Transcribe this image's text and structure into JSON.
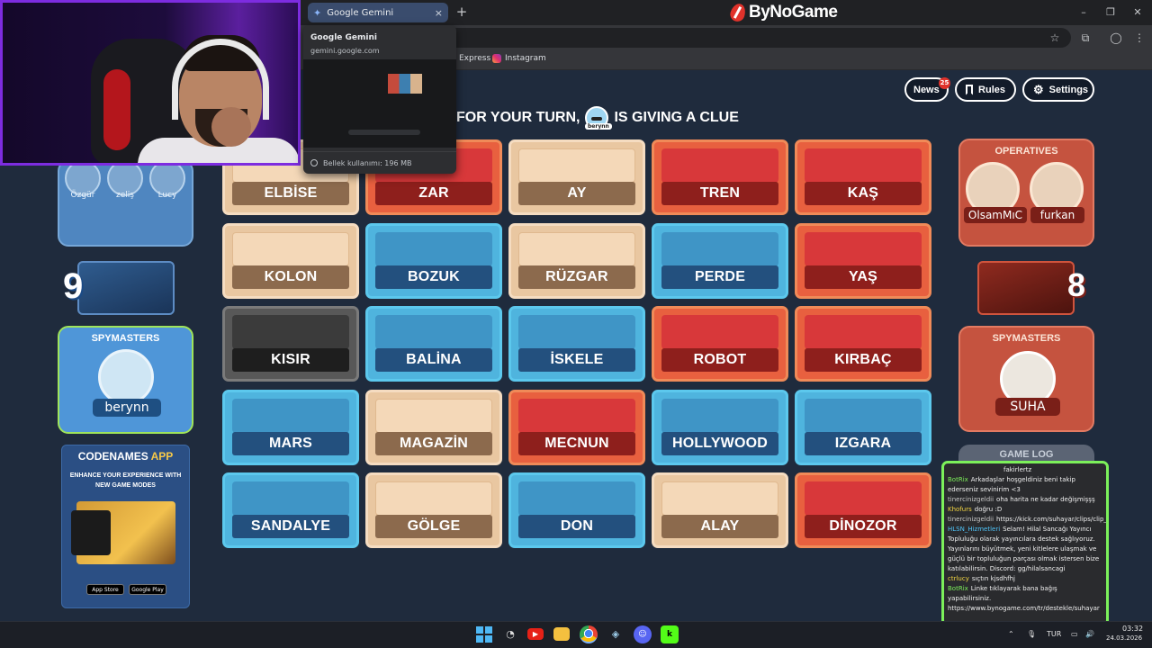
{
  "browser": {
    "tab_title": "Google Gemini",
    "tab_close": "×",
    "new_tab": "+",
    "brand": "ByNoGame",
    "window_controls": [
      "–",
      "❐",
      "✕"
    ],
    "bookmarks": [
      "Express",
      "Instagram"
    ]
  },
  "hover_card": {
    "title": "Google Gemini",
    "url": "gemini.google.com",
    "memory": "Bellek kullanımı: 196 MB"
  },
  "header": {
    "news_label": "News",
    "news_badge": "25",
    "rules_label": "Rules",
    "settings_label": "Settings",
    "status_text": "FOR YOUR TURN,",
    "status_suffix": "IS GIVING A CLUE",
    "clue_giver": "berynn"
  },
  "board": {
    "cards": [
      {
        "word": "ELBİSE",
        "color": "neutral"
      },
      {
        "word": "ZAR",
        "color": "red"
      },
      {
        "word": "AY",
        "color": "neutral"
      },
      {
        "word": "TREN",
        "color": "red"
      },
      {
        "word": "KAŞ",
        "color": "red"
      },
      {
        "word": "KOLON",
        "color": "neutral"
      },
      {
        "word": "BOZUK",
        "color": "blue"
      },
      {
        "word": "RÜZGAR",
        "color": "neutral"
      },
      {
        "word": "PERDE",
        "color": "blue"
      },
      {
        "word": "YAŞ",
        "color": "red"
      },
      {
        "word": "KISIR",
        "color": "assassin"
      },
      {
        "word": "BALİNA",
        "color": "blue"
      },
      {
        "word": "İSKELE",
        "color": "blue"
      },
      {
        "word": "ROBOT",
        "color": "red"
      },
      {
        "word": "KIRBAÇ",
        "color": "red"
      },
      {
        "word": "MARS",
        "color": "blue"
      },
      {
        "word": "MAGAZİN",
        "color": "neutral"
      },
      {
        "word": "MECNUN",
        "color": "red"
      },
      {
        "word": "HOLLYWOOD",
        "color": "blue"
      },
      {
        "word": "IZGARA",
        "color": "blue"
      },
      {
        "word": "SANDALYE",
        "color": "blue"
      },
      {
        "word": "GÖLGE",
        "color": "neutral"
      },
      {
        "word": "DON",
        "color": "blue"
      },
      {
        "word": "ALAY",
        "color": "neutral"
      },
      {
        "word": "DİNOZOR",
        "color": "red"
      }
    ]
  },
  "blue_team": {
    "operatives": [
      "Özgür",
      "zeliş",
      "Lucy"
    ],
    "remaining": "9",
    "spymasters_title": "SPYMASTERS",
    "spymaster": "berynn"
  },
  "red_team": {
    "operatives_title": "OPERATIVES",
    "operatives": [
      "OlsamMıC",
      "furkan"
    ],
    "remaining": "8",
    "spymasters_title": "SPYMASTERS",
    "spymaster": "SUHA"
  },
  "app_ad": {
    "title_a": "CODENAMES",
    "title_b": "APP",
    "subtitle": "ENHANCE YOUR EXPERIENCE WITH NEW GAME MODES",
    "app_store": "App Store",
    "google_play": "Google Play"
  },
  "game_log_label": "GAME LOG",
  "chat": [
    {
      "user": "",
      "color": "#ffffff",
      "text": "fakirlertz"
    },
    {
      "user": "BotRix",
      "color": "#7cf05a",
      "text": "Arkadaşlar hoşgeldiniz beni takip ederseniz sevinirim <3"
    },
    {
      "user": "tinercinizgeldii",
      "color": "#c9c9c9",
      "text": "oha harita ne kadar değişmişşş"
    },
    {
      "user": "Khofurs",
      "color": "#f5d742",
      "text": "doğru :D"
    },
    {
      "user": "tinercinizgeldii",
      "color": "#c9c9c9",
      "text": "https://kick.com/suhayar/clips/clip_01KM"
    },
    {
      "user": "HLSN_Hizmetleri",
      "color": "#4fc3f7",
      "text": "Selam! Hilal Sancağı Yayıncı Topluluğu olarak yayıncılara destek sağlıyoruz. Yayınlarını büyütmek, yeni kitlelere ulaşmak ve güçlü bir topluluğun parçası olmak istersen bize katılabilirsin. Discord: gg/hilalsancagi"
    },
    {
      "user": "ctrlucy",
      "color": "#f5d742",
      "text": "sıçtın kjsdhfhj"
    },
    {
      "user": "BotRix",
      "color": "#7cf05a",
      "text": "Linke tıklayarak bana bağış yapabilirsiniz. https://www.bynogame.com/tr/destekle/suhayar"
    }
  ],
  "taskbar": {
    "lang": "TUR",
    "time": "03:32",
    "date": "24.03.2026"
  }
}
